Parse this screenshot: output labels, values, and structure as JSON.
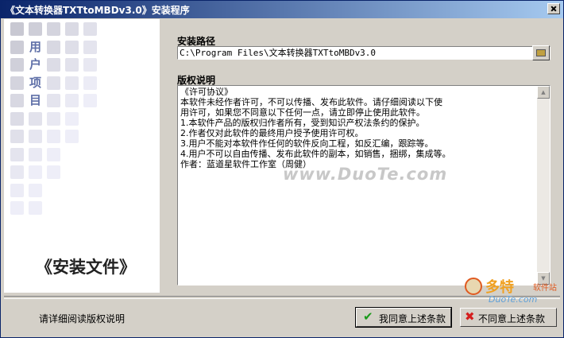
{
  "window": {
    "title": "《文本转换器TXTtoMBDv3.0》安装程序"
  },
  "sidebar": {
    "vertical_text": [
      "用",
      "户",
      "项",
      "目"
    ],
    "install_text": "《安装文件》"
  },
  "install_path": {
    "label": "安装路径",
    "value": "C:\\Program Files\\文本转换器TXTtoMBDv3.0"
  },
  "license": {
    "label": "版权说明",
    "lines": [
      "《许可协议》",
      "    本软件未经作者许可，不可以传播、发布此软件。请仔细阅读以下使",
      "用许可，如果您不同意以下任何一点，请立即停止使用此软件。",
      "1.本软件产品的版权归作者所有，受到知识产权法条约的保护。",
      "2.作者仅对此软件的最终用户授予使用许可权。",
      "3.用户不能对本软件作任何的软件反向工程，如反汇编，跟踪等。",
      "4.用户不可以自由传播、发布此软件的副本，如销售，捆绑，集成等。",
      "作者：蓝道星软件工作室（周健）"
    ]
  },
  "watermark": "www.DuoTe.com",
  "status_text": "请详细阅读版权说明",
  "buttons": {
    "agree": "我同意上述条款",
    "disagree": "不同意上述条款"
  },
  "corner_logo": {
    "big": "多特",
    "small": "软件站",
    "sub": "DuoTe.com"
  },
  "colors": {
    "title_gradient_start": "#0a246a",
    "title_gradient_end": "#a6caf0",
    "vertical_text": "#5f70a8",
    "agree_icon": "#1a9a1a",
    "disagree_icon": "#d41e1e"
  }
}
